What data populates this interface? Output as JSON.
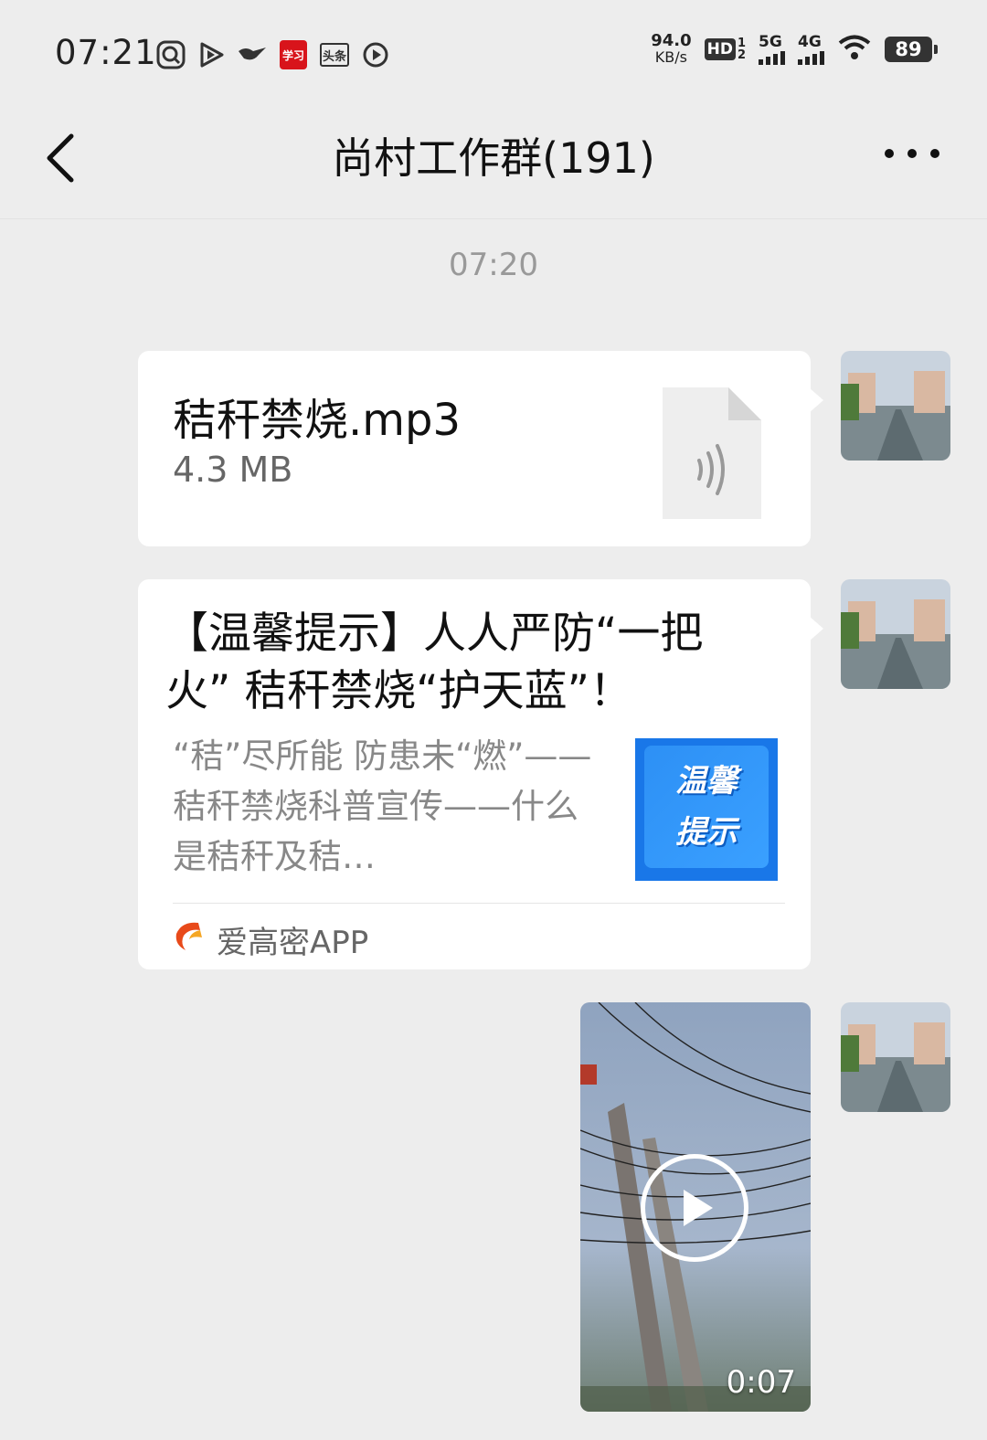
{
  "status_bar": {
    "time": "07:21",
    "net_speed_value": "94.0",
    "net_speed_unit": "KB/s",
    "hd_label": "HD",
    "sim1_type": "5G",
    "sim2_type": "4G",
    "battery": "89",
    "app_icons": [
      "browser-icon",
      "play-icon",
      "bird-icon",
      "xuexi-icon",
      "toutiao-icon",
      "video-icon"
    ],
    "toutiao_label": "头条",
    "xuexi_label": "学习"
  },
  "nav": {
    "title": "尚村工作群(191)"
  },
  "timestamp": "07:20",
  "messages": [
    {
      "type": "file",
      "file_name": "秸秆禁烧.mp3",
      "file_size": "4.3 MB"
    },
    {
      "type": "article",
      "title": "【温馨提示】人人严防“一把火” 秸秆禁烧“护天蓝”！",
      "description": "“秸”尽所能 防患未“燃”——秸秆禁烧科普宣传——什么是秸秆及秸…",
      "thumb_text_1": "温馨",
      "thumb_text_2": "提示",
      "source": "爱高密APP"
    },
    {
      "type": "video",
      "duration": "0:07"
    }
  ],
  "colors": {
    "background": "#ededed",
    "bubble": "#ffffff",
    "thumb_blue": "#1977e8"
  }
}
